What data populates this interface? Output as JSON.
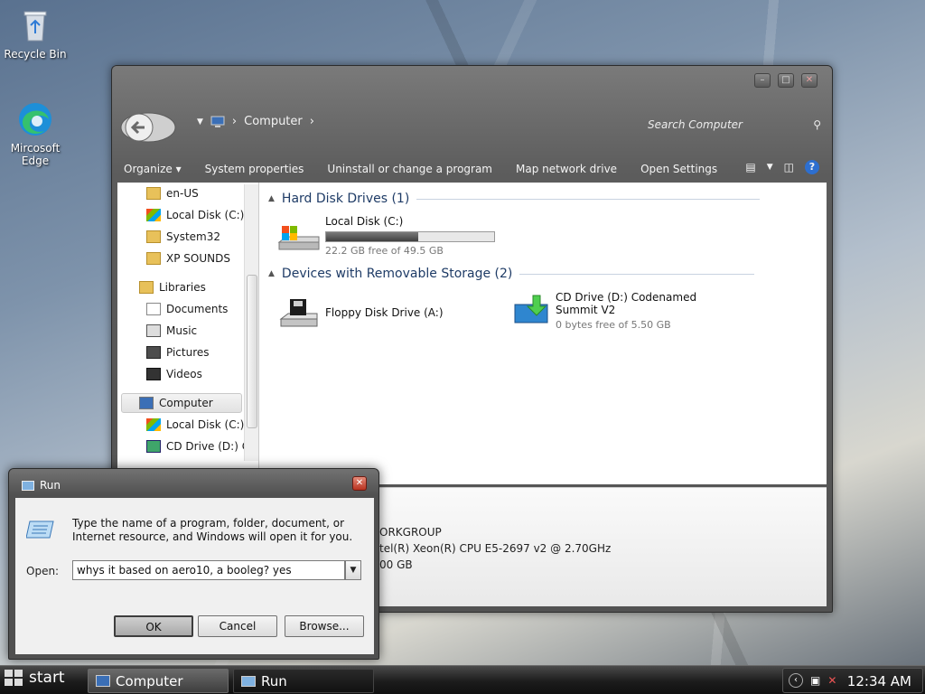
{
  "desktop": {
    "icons": [
      {
        "label": "Recycle Bin"
      },
      {
        "label": "Mircosoft Edge"
      }
    ]
  },
  "explorer": {
    "address": {
      "location": "Computer"
    },
    "search": {
      "placeholder": "Search Computer"
    },
    "toolbar": {
      "organize": "Organize",
      "system_properties": "System properties",
      "uninstall": "Uninstall or change a program",
      "map_drive": "Map network drive",
      "open_settings": "Open Settings"
    },
    "nav": {
      "items": [
        {
          "label": "en-US"
        },
        {
          "label": "Local Disk (C:)"
        },
        {
          "label": "System32"
        },
        {
          "label": "XP SOUNDS"
        },
        {
          "label": "Libraries"
        },
        {
          "label": "Documents"
        },
        {
          "label": "Music"
        },
        {
          "label": "Pictures"
        },
        {
          "label": "Videos"
        },
        {
          "label": "Computer"
        },
        {
          "label": "Local Disk (C:)"
        },
        {
          "label": "CD Drive (D:) Co"
        }
      ]
    },
    "groups": {
      "hdd": {
        "header": "Hard Disk Drives (1)",
        "drive_name": "Local Disk (C:)",
        "free_text": "22.2 GB free of 49.5 GB",
        "used_fraction": 0.55
      },
      "removable": {
        "header": "Devices with Removable Storage (2)",
        "floppy": "Floppy Disk Drive (A:)",
        "cd_name": "CD Drive (D:) Codenamed Summit V2",
        "cd_free": "0 bytes free of 5.50 GB"
      }
    },
    "details": {
      "workgroup": "ORKGROUP",
      "processor": "tel(R) Xeon(R) CPU E5-2697 v2 @ 2.70GHz",
      "memory": "00 GB"
    }
  },
  "run": {
    "title": "Run",
    "message": "Type the name of a program, folder, document, or Internet resource, and Windows will open it for you.",
    "open_label": "Open:",
    "input_value": "whys it based on aero10, a booleg? yes",
    "ok": "OK",
    "cancel": "Cancel",
    "browse": "Browse..."
  },
  "taskbar": {
    "start": "start",
    "tasks": [
      {
        "label": "Computer"
      },
      {
        "label": "Run"
      }
    ],
    "clock": "12:34 AM"
  }
}
